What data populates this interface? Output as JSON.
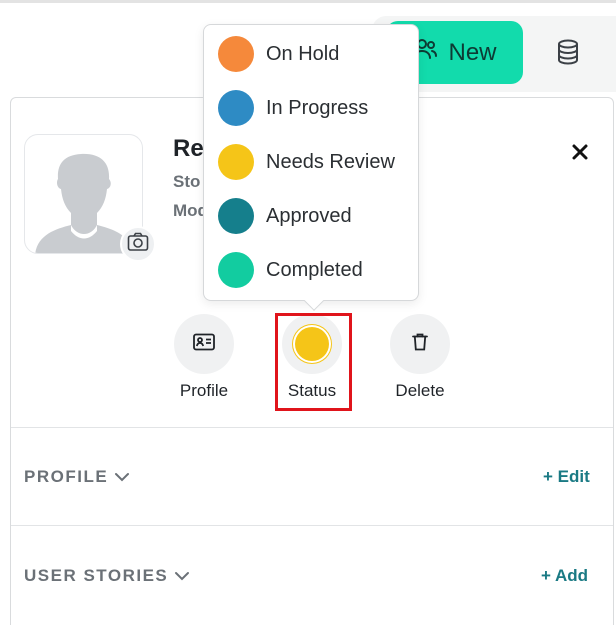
{
  "header": {
    "new_label": "New",
    "new_icon": "users-icon",
    "db_icon": "database-icon"
  },
  "record": {
    "name": "Re",
    "line1": "Sto",
    "line2": "Mod"
  },
  "actions": [
    {
      "label": "Profile",
      "icon": "id-card-icon"
    },
    {
      "label": "Status",
      "icon": "status-dot",
      "color": "#f5c518"
    },
    {
      "label": "Delete",
      "icon": "trash-icon"
    }
  ],
  "status_menu": {
    "items": [
      {
        "label": "On Hold",
        "color": "#f5893b"
      },
      {
        "label": "In Progress",
        "color": "#2e8bc4"
      },
      {
        "label": "Needs Review",
        "color": "#f5c518"
      },
      {
        "label": "Approved",
        "color": "#157f8c"
      },
      {
        "label": "Completed",
        "color": "#12cca0"
      }
    ]
  },
  "sections": [
    {
      "title": "PROFILE",
      "action": "+ Edit"
    },
    {
      "title": "USER STORIES",
      "action": "+ Add"
    }
  ],
  "colors": {
    "accent": "#12dbac",
    "link": "#1a7a84",
    "highlight": "#e0141b"
  }
}
